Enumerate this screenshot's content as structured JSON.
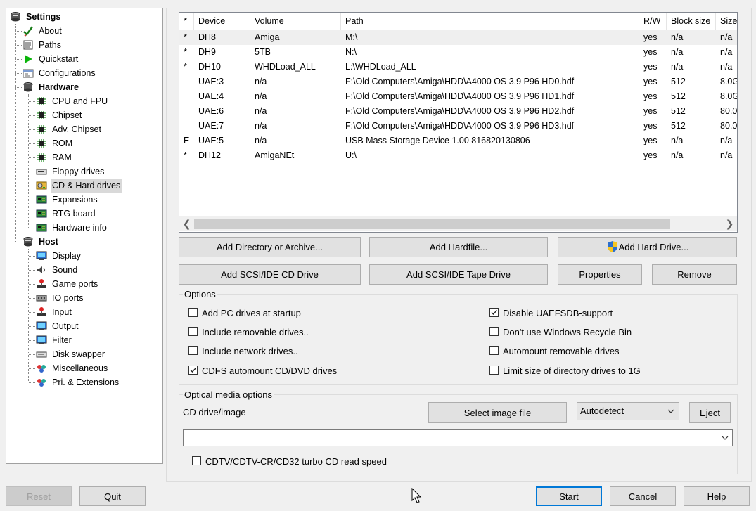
{
  "tree": {
    "items": [
      {
        "label": "Settings",
        "icon": "settings-icon"
      },
      {
        "label": "About",
        "icon": "checkmark-icon"
      },
      {
        "label": "Paths",
        "icon": "paths-icon"
      },
      {
        "label": "Quickstart",
        "icon": "play-icon"
      },
      {
        "label": "Configurations",
        "icon": "config-icon"
      },
      {
        "label": "Hardware",
        "icon": "hardware-icon"
      },
      {
        "label": "CPU and FPU",
        "icon": "chip-icon"
      },
      {
        "label": "Chipset",
        "icon": "chip-icon"
      },
      {
        "label": "Adv. Chipset",
        "icon": "chip-icon"
      },
      {
        "label": "ROM",
        "icon": "chip-icon"
      },
      {
        "label": "RAM",
        "icon": "chip-icon"
      },
      {
        "label": "Floppy drives",
        "icon": "floppy-drive-icon"
      },
      {
        "label": "CD & Hard drives",
        "icon": "hard-drive-icon"
      },
      {
        "label": "Expansions",
        "icon": "board-icon"
      },
      {
        "label": "RTG board",
        "icon": "board-icon"
      },
      {
        "label": "Hardware info",
        "icon": "board-icon"
      },
      {
        "label": "Host",
        "icon": "host-icon"
      },
      {
        "label": "Display",
        "icon": "monitor-icon"
      },
      {
        "label": "Sound",
        "icon": "speaker-icon"
      },
      {
        "label": "Game ports",
        "icon": "joystick-icon"
      },
      {
        "label": "IO ports",
        "icon": "io-port-icon"
      },
      {
        "label": "Input",
        "icon": "joystick-icon"
      },
      {
        "label": "Output",
        "icon": "monitor-icon"
      },
      {
        "label": "Filter",
        "icon": "monitor-icon"
      },
      {
        "label": "Disk swapper",
        "icon": "floppy-drive-icon"
      },
      {
        "label": "Miscellaneous",
        "icon": "misc-icon"
      },
      {
        "label": "Pri. & Extensions",
        "icon": "misc-icon"
      }
    ]
  },
  "drives": {
    "columns": [
      "*",
      "Device",
      "Volume",
      "Path",
      "R/W",
      "Block size",
      "Size"
    ],
    "rows": [
      {
        "flag": "*",
        "device": "DH8",
        "volume": "Amiga",
        "path": "M:\\",
        "rw": "yes",
        "block": "n/a",
        "size": "n/a"
      },
      {
        "flag": "*",
        "device": "DH9",
        "volume": "5TB",
        "path": "N:\\",
        "rw": "yes",
        "block": "n/a",
        "size": "n/a"
      },
      {
        "flag": "*",
        "device": "DH10",
        "volume": "WHDLoad_ALL",
        "path": "L:\\WHDLoad_ALL",
        "rw": "yes",
        "block": "n/a",
        "size": "n/a"
      },
      {
        "flag": "",
        "device": "UAE:3",
        "volume": "n/a",
        "path": "F:\\Old Computers\\Amiga\\HDD\\A4000 OS 3.9 P96 HD0.hdf",
        "rw": "yes",
        "block": "512",
        "size": "8.0G"
      },
      {
        "flag": "",
        "device": "UAE:4",
        "volume": "n/a",
        "path": "F:\\Old Computers\\Amiga\\HDD\\A4000 OS 3.9 P96 HD1.hdf",
        "rw": "yes",
        "block": "512",
        "size": "8.0G"
      },
      {
        "flag": "",
        "device": "UAE:6",
        "volume": "n/a",
        "path": "F:\\Old Computers\\Amiga\\HDD\\A4000 OS 3.9 P96 HD2.hdf",
        "rw": "yes",
        "block": "512",
        "size": "80.0"
      },
      {
        "flag": "",
        "device": "UAE:7",
        "volume": "n/a",
        "path": "F:\\Old Computers\\Amiga\\HDD\\A4000 OS 3.9 P96 HD3.hdf",
        "rw": "yes",
        "block": "512",
        "size": "80.0"
      },
      {
        "flag": "E",
        "device": "UAE:5",
        "volume": "n/a",
        "path": "USB Mass Storage Device 1.00 816820130806",
        "rw": "yes",
        "block": "n/a",
        "size": "n/a"
      },
      {
        "flag": "*",
        "device": "DH12",
        "volume": "AmigaNEt",
        "path": "U:\\",
        "rw": "yes",
        "block": "n/a",
        "size": "n/a"
      }
    ]
  },
  "buttons": {
    "add_directory": "Add Directory or Archive...",
    "add_hardfile": "Add Hardfile...",
    "add_hard_drive": "Add Hard Drive...",
    "add_scsi_cd": "Add SCSI/IDE CD Drive",
    "add_scsi_tape": "Add SCSI/IDE Tape Drive",
    "properties": "Properties",
    "remove": "Remove"
  },
  "options": {
    "title": "Options",
    "items": [
      {
        "label": "Add PC drives at startup",
        "checked": false
      },
      {
        "label": "Include removable drives..",
        "checked": false
      },
      {
        "label": "Include network drives..",
        "checked": false
      },
      {
        "label": "CDFS automount CD/DVD drives",
        "checked": true
      },
      {
        "label": "Disable UAEFSDB-support",
        "checked": true
      },
      {
        "label": "Don't use Windows Recycle Bin",
        "checked": false
      },
      {
        "label": "Automount removable drives",
        "checked": false
      },
      {
        "label": "Limit size of directory drives to 1G",
        "checked": false
      }
    ]
  },
  "optical": {
    "title": "Optical media options",
    "cd_label": "CD drive/image",
    "select_image": "Select image file",
    "mode_selected": "Autodetect",
    "eject": "Eject",
    "image_path": "",
    "turbo_label": "CDTV/CDTV-CR/CD32 turbo CD read speed",
    "turbo_checked": false
  },
  "footer": {
    "reset": "Reset",
    "quit": "Quit",
    "start": "Start",
    "cancel": "Cancel",
    "help": "Help"
  },
  "colors": {
    "accent": "#0078d7",
    "selection": "#d9d9d9"
  }
}
